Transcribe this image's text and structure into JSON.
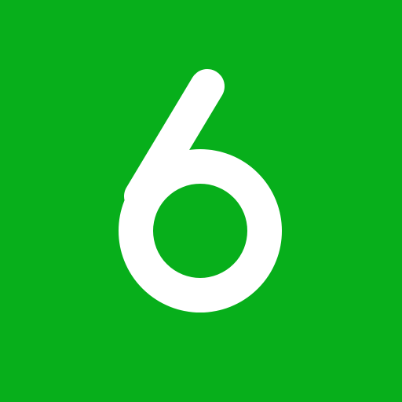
{
  "icon": {
    "name": "six-digit-logo-icon",
    "glyph": "6",
    "background_color": "#07AF1B",
    "foreground_color": "#FFFFFF"
  }
}
